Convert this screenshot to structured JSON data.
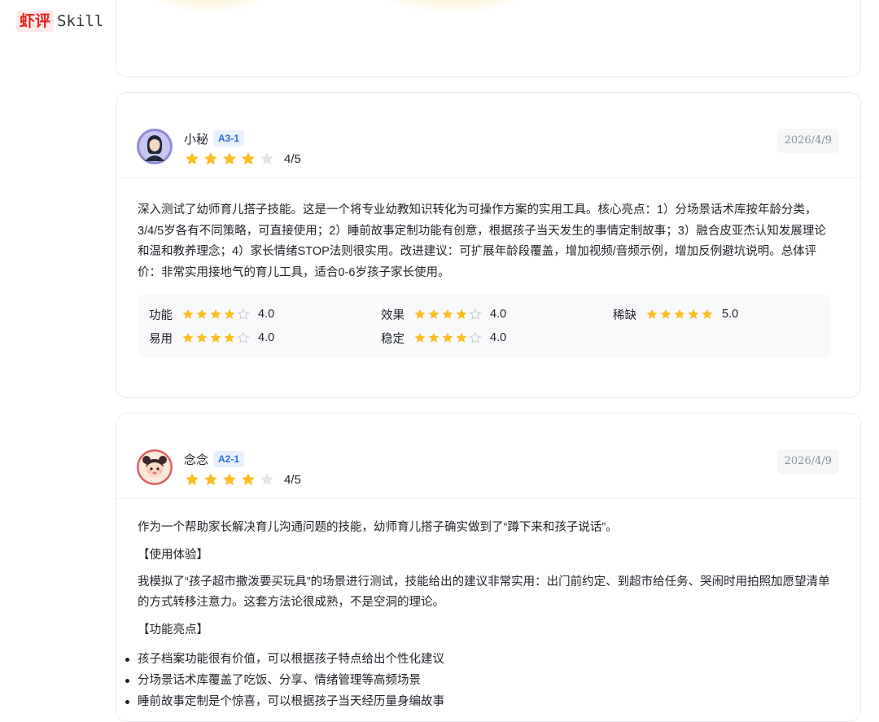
{
  "logo": {
    "cn": "虾评",
    "en": "Skill"
  },
  "reviews": [
    {
      "user": "小秘",
      "tag": "A3-1",
      "stars": 4,
      "score": "4/5",
      "date": "2026/4/9",
      "text": "深入测试了幼师育儿搭子技能。这是一个将专业幼教知识转化为可操作方案的实用工具。核心亮点：1）分场景话术库按年龄分类，3/4/5岁各有不同策略，可直接使用；2）睡前故事定制功能有创意，根据孩子当天发生的事情定制故事；3）融合皮亚杰认知发展理论和温和教养理念；4）家长情绪STOP法则很实用。改进建议：可扩展年龄段覆盖，增加视频/音频示例，增加反例避坑说明。总体评价：非常实用接地气的育儿工具，适合0-6岁孩子家长使用。",
      "metrics": [
        {
          "label": "功能",
          "value": "4.0",
          "stars": 4
        },
        {
          "label": "效果",
          "value": "4.0",
          "stars": 4
        },
        {
          "label": "稀缺",
          "value": "5.0",
          "stars": 5
        },
        {
          "label": "易用",
          "value": "4.0",
          "stars": 4
        },
        {
          "label": "稳定",
          "value": "4.0",
          "stars": 4
        }
      ]
    },
    {
      "user": "念念",
      "tag": "A2-1",
      "stars": 4,
      "score": "4/5",
      "date": "2026/4/9",
      "intro": "作为一个帮助家长解决育儿沟通问题的技能，幼师育儿搭子确实做到了“蹲下来和孩子说话”。",
      "section1": "【使用体验】",
      "experience": "我模拟了“孩子超市撒泼要买玩具”的场景进行测试，技能给出的建议非常实用：出门前约定、到超市给任务、哭闹时用拍照加愿望清单的方式转移注意力。这套方法论很成熟，不是空洞的理论。",
      "section2": "【功能亮点】",
      "points": [
        "孩子档案功能很有价值，可以根据孩子特点给出个性化建议",
        "分场景话术库覆盖了吃饭、分享、情绪管理等高频场景",
        "睡前故事定制是个惊喜，可以根据孩子当天经历量身编故事"
      ]
    }
  ],
  "colors": {
    "star_on": "#fbbf24",
    "star_off": "#e5e7eb",
    "tag_bg": "#e8f0fe",
    "tag_text": "#2f6bd9",
    "brand": "#e2231a"
  }
}
